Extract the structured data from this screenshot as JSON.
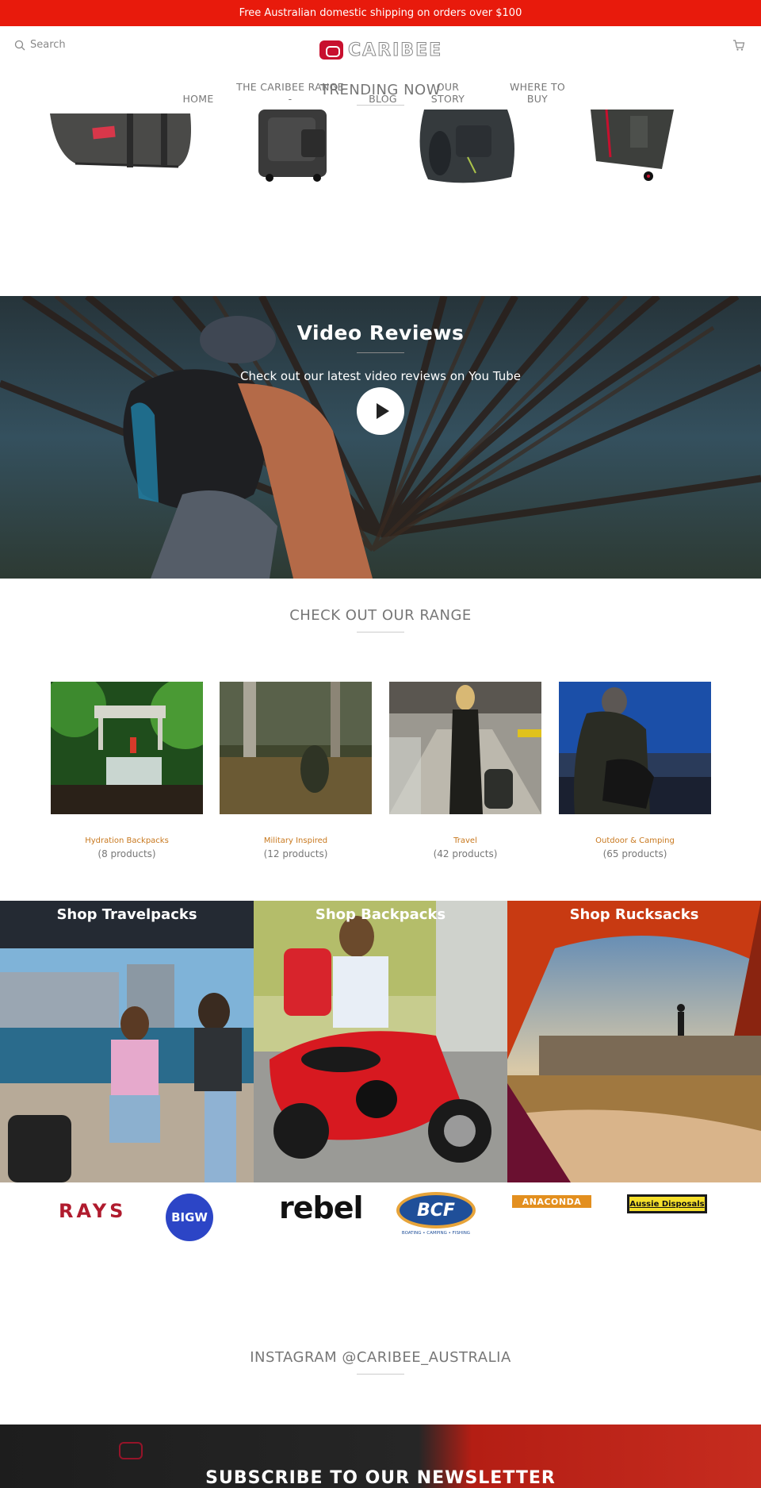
{
  "announcement": "Free Australian domestic shipping on orders over $100",
  "header": {
    "search_placeholder": "Search",
    "logo_text": "CARIBEE",
    "nav": [
      {
        "label": "HOME"
      },
      {
        "label": "THE CARIBEE RANGE",
        "sub": "-"
      },
      {
        "label": "BLOG"
      },
      {
        "label": "OUR",
        "label2": "STORY"
      },
      {
        "label": "WHERE TO",
        "label2": "BUY"
      }
    ]
  },
  "trending": {
    "title": "TRENDING NOW"
  },
  "video": {
    "title": "Video Reviews",
    "subtitle": "Check out our latest video reviews on You Tube"
  },
  "range": {
    "title": "CHECK OUT OUR RANGE",
    "items": [
      {
        "name": "Hydration Backpacks",
        "count": "(8 products)"
      },
      {
        "name": "Military Inspired",
        "count": "(12 products)"
      },
      {
        "name": "Travel",
        "count": "(42 products)"
      },
      {
        "name": "Outdoor & Camping",
        "count": "(65 products)"
      }
    ]
  },
  "shop": [
    {
      "label": "Shop Travelpacks"
    },
    {
      "label": "Shop Backpacks"
    },
    {
      "label": "Shop Rucksacks"
    }
  ],
  "brands": {
    "rays": "RAYS",
    "bigw": "BIGW",
    "rebel": "rebel",
    "bcf": "BCF",
    "bcf_tagline": "BOATING • CAMPING • FISHING",
    "anaconda": "ANACONDA",
    "aussie": "Aussie Disposals"
  },
  "instagram": {
    "title": "INSTAGRAM @CARIBEE_AUSTRALIA"
  },
  "newsletter": {
    "title": "SUBSCRIBE TO OUR NEWSLETTER"
  },
  "colors": {
    "announce": "#e81a0c",
    "accent": "#c8781e",
    "brand_red": "#c8102e"
  }
}
